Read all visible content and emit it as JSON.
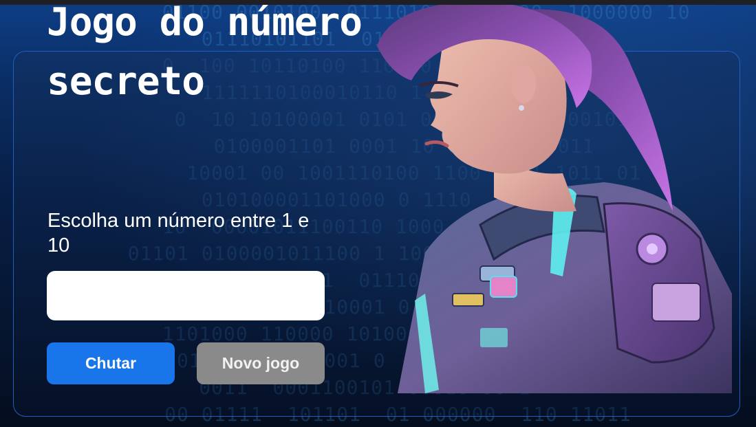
{
  "title": "Jogo do número secreto",
  "instruction": "Escolha um número entre 1 e 10",
  "input": {
    "value": "",
    "placeholder": ""
  },
  "buttons": {
    "guess": "Chutar",
    "new_game": "Novo jogo"
  },
  "colors": {
    "accent": "#1976ea",
    "disabled_button": "#8a8a8a",
    "card_border": "#1f5fbf"
  },
  "illustration": "astronaut-girl-illustration"
}
